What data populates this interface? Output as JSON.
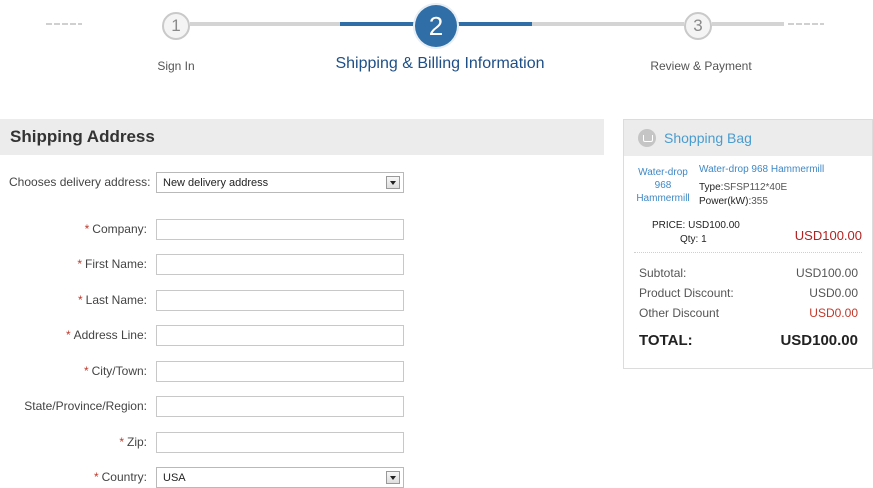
{
  "steps": [
    {
      "number": "1",
      "label": "Sign In",
      "state": "done"
    },
    {
      "number": "2",
      "label": "Shipping & Billing Information",
      "state": "current"
    },
    {
      "number": "3",
      "label": "Review & Payment",
      "state": "upcoming"
    }
  ],
  "shipping": {
    "title": "Shipping Address",
    "delivery_label": "Chooses delivery address:",
    "delivery_value": "New delivery address",
    "fields": [
      {
        "label": "Company:",
        "required": true,
        "value": ""
      },
      {
        "label": "First Name:",
        "required": true,
        "value": ""
      },
      {
        "label": "Last Name:",
        "required": true,
        "value": ""
      },
      {
        "label": "Address Line:",
        "required": true,
        "value": ""
      },
      {
        "label": "City/Town:",
        "required": true,
        "value": ""
      },
      {
        "label": "State/Province/Region:",
        "required": false,
        "value": ""
      },
      {
        "label": "Zip:",
        "required": true,
        "value": ""
      }
    ],
    "country_label": "Country:",
    "country_value": "USA",
    "required_mark": "*"
  },
  "bag": {
    "title": "Shopping Bag",
    "item": {
      "thumb_line1": "Water-drop",
      "thumb_line2": "968",
      "thumb_line3": "Hammermill",
      "name": "Water-drop 968 Hammermill",
      "type_label": "Type:",
      "type_value": "SFSP112*40E",
      "power_label": "Power(kW):",
      "power_value": "355",
      "price_text": "PRICE: USD100.00",
      "qty_text": "Qty: 1",
      "line_total": "USD100.00"
    },
    "summary": [
      {
        "label": "Subtotal:",
        "value": "USD100.00"
      },
      {
        "label": "Product Discount:",
        "value": "USD0.00"
      },
      {
        "label": "Other Discount",
        "value": "USD0.00"
      }
    ],
    "total_label": "TOTAL:",
    "total_value": "USD100.00"
  },
  "colors": {
    "accent": "#2f6ea7",
    "link": "#3f88c5",
    "price_red": "#b22222"
  }
}
